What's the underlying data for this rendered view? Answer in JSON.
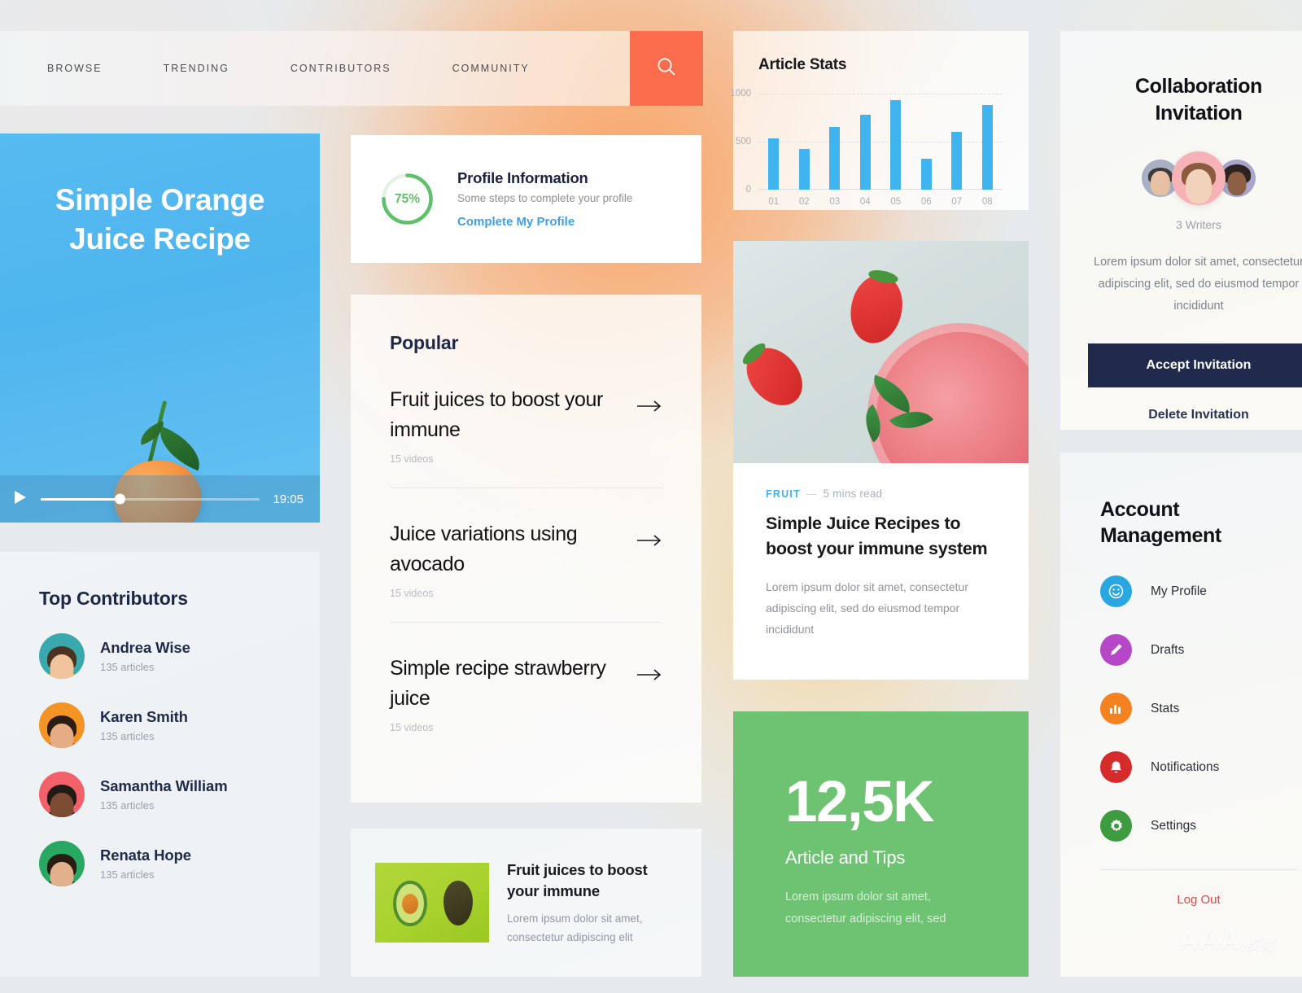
{
  "nav": {
    "links": [
      {
        "label": "BROWSE"
      },
      {
        "label": "TRENDING"
      },
      {
        "label": "CONTRIBUTORS"
      },
      {
        "label": "COMMUNITY"
      }
    ],
    "search_icon": "search-icon",
    "search_color": "#fb6d4c"
  },
  "hero": {
    "title_line1": "Simple Orange",
    "title_line2": "Juice Recipe",
    "play_icon": "play-icon",
    "duration": "19:05",
    "progress_percent": 36
  },
  "contributors": {
    "title": "Top Contributors",
    "items": [
      {
        "name": "Andrea Wise",
        "articles": "135 articles",
        "avatar_color": "#3aa9ad"
      },
      {
        "name": "Karen Smith",
        "articles": "135 articles",
        "avatar_color": "#f49426"
      },
      {
        "name": "Samantha William",
        "articles": "135 articles",
        "avatar_color": "#f2606a"
      },
      {
        "name": "Renata Hope",
        "articles": "135 articles",
        "avatar_color": "#28a862"
      }
    ]
  },
  "profile": {
    "percent": "75%",
    "percent_value": 75,
    "title": "Profile Information",
    "subtitle": "Some steps to complete your profile",
    "link": "Complete My Profile",
    "ring_color": "#5fc06a",
    "link_color": "#3fa0e8"
  },
  "popular": {
    "title": "Popular",
    "items": [
      {
        "title": "Fruit juices to boost your immune",
        "meta": "15 videos",
        "arrow": "arrow-right-icon"
      },
      {
        "title": "Juice variations using avocado",
        "meta": "15 videos",
        "arrow": "arrow-right-icon"
      },
      {
        "title": "Simple recipe strawberry juice",
        "meta": "15 videos",
        "arrow": "arrow-right-icon"
      }
    ]
  },
  "mini_article": {
    "title": "Fruit juices to boost your immune",
    "desc": "Lorem ipsum dolor sit amet, consectetur adipiscing elit",
    "thumb_alt": "avocado-photo"
  },
  "chart_data": {
    "type": "bar",
    "title": "Article Stats",
    "categories": [
      "01",
      "02",
      "03",
      "04",
      "05",
      "06",
      "07",
      "08"
    ],
    "values": [
      530,
      420,
      650,
      780,
      930,
      320,
      600,
      880
    ],
    "xlabel": "",
    "ylabel": "",
    "ylim": [
      0,
      1000
    ],
    "yticks": [
      0,
      500,
      1000
    ],
    "ytick_labels": [
      "0",
      "500",
      "1000"
    ],
    "grid": true,
    "legend": "none",
    "bar_color": "#3fb4ef"
  },
  "article": {
    "tag": "FRUIT",
    "dash": "—",
    "read_time": "5 mins read",
    "title": "Simple Juice Recipes to boost your immune system",
    "desc": "Lorem ipsum dolor sit amet, consectetur adipiscing elit, sed do eiusmod tempor incididunt",
    "photo_alt": "strawberry-smoothie-photo",
    "tag_color": "#3fb4ef"
  },
  "green_stat": {
    "number": "12,5K",
    "label": "Article and Tips",
    "desc": "Lorem ipsum dolor sit amet, consectetur adipiscing elit, sed",
    "bg_color": "#6ec373"
  },
  "invitation": {
    "title_line1": "Collaboration",
    "title_line2": "Invitation",
    "writers_count": "3 Writers",
    "blurb": "Lorem ipsum dolor sit amet, consectetur adipiscing elit, sed do eiusmod tempor incididunt",
    "accept_label": "Accept Invitation",
    "delete_label": "Delete Invitation",
    "accept_bg": "#1f2a4d",
    "avatars": [
      {
        "name": "writer-avatar-1",
        "bg": "#a9b0c4"
      },
      {
        "name": "writer-avatar-2",
        "bg": "#f5b3b8"
      },
      {
        "name": "writer-avatar-3",
        "bg": "#a9a6c9"
      }
    ]
  },
  "account": {
    "title_line1": "Account",
    "title_line2": "Management",
    "items": [
      {
        "label": "My Profile",
        "icon": "smiley-face-icon",
        "color": "#2aa6e0"
      },
      {
        "label": "Drafts",
        "icon": "pencil-icon",
        "color": "#b648c8"
      },
      {
        "label": "Stats",
        "icon": "bar-chart-icon",
        "color": "#f58220"
      },
      {
        "label": "Notifications",
        "icon": "bell-icon",
        "color": "#d62b2b"
      },
      {
        "label": "Settings",
        "icon": "gear-icon",
        "color": "#3f9b3f"
      }
    ],
    "logout": "Log Out",
    "logout_color": "#e04646"
  },
  "watermark": {
    "text": "AAA",
    "cn": "教育"
  }
}
